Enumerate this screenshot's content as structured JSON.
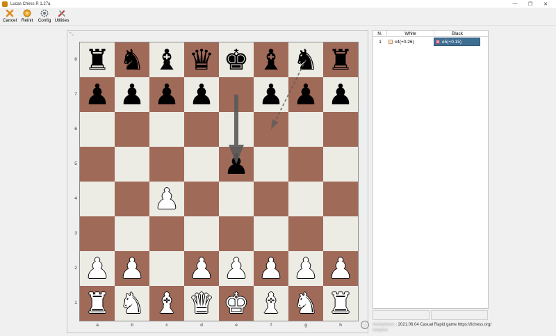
{
  "window": {
    "title": "Lucas Chess R 1.27a",
    "minimize": "—",
    "maximize": "❐",
    "close": "✕"
  },
  "toolbar": [
    {
      "label": "Cancel",
      "icon": "cancel-icon"
    },
    {
      "label": "Reinit",
      "icon": "reinit-icon"
    },
    {
      "label": "Config",
      "icon": "config-icon"
    },
    {
      "label": "Utilities",
      "icon": "utilities-icon"
    }
  ],
  "board": {
    "files": [
      "a",
      "b",
      "c",
      "d",
      "e",
      "f",
      "g",
      "h"
    ],
    "ranks": [
      "8",
      "7",
      "6",
      "5",
      "4",
      "3",
      "2",
      "1"
    ],
    "position": [
      [
        "r",
        "n",
        "b",
        "q",
        "k",
        "b",
        "n",
        "r"
      ],
      [
        "p",
        "p",
        "p",
        "p",
        "",
        "p",
        "p",
        "p"
      ],
      [
        "",
        "",
        "",
        "",
        "",
        "",
        "",
        ""
      ],
      [
        "",
        "",
        "",
        "",
        "p",
        "",
        "",
        ""
      ],
      [
        "",
        "",
        "P",
        "",
        "",
        "",
        "",
        ""
      ],
      [
        "",
        "",
        "",
        "",
        "",
        "",
        "",
        ""
      ],
      [
        "P",
        "P",
        "",
        "P",
        "P",
        "P",
        "P",
        "P"
      ],
      [
        "R",
        "N",
        "B",
        "Q",
        "K",
        "B",
        "N",
        "R"
      ]
    ],
    "arrows": [
      {
        "from": "e7",
        "to": "e5",
        "style": "solid"
      },
      {
        "from": "g8",
        "to": "f6",
        "style": "dashed"
      }
    ],
    "colors": {
      "light": "#ecebe4",
      "dark": "#a06a59",
      "arrow": "#5a5a5a"
    }
  },
  "moves": {
    "headers": {
      "number": "N.",
      "white": "White",
      "black": "Black"
    },
    "rows": [
      {
        "number": "1",
        "white": "c4(+0.26)",
        "black": "e5(+0.15)"
      }
    ],
    "selected_color": "#3f6e93"
  },
  "game_info": {
    "player": "Anonymous",
    "text": ": 2021.06.04 Casual Rapid game https://lichess.org/",
    "code": "Gnqxxvr"
  }
}
